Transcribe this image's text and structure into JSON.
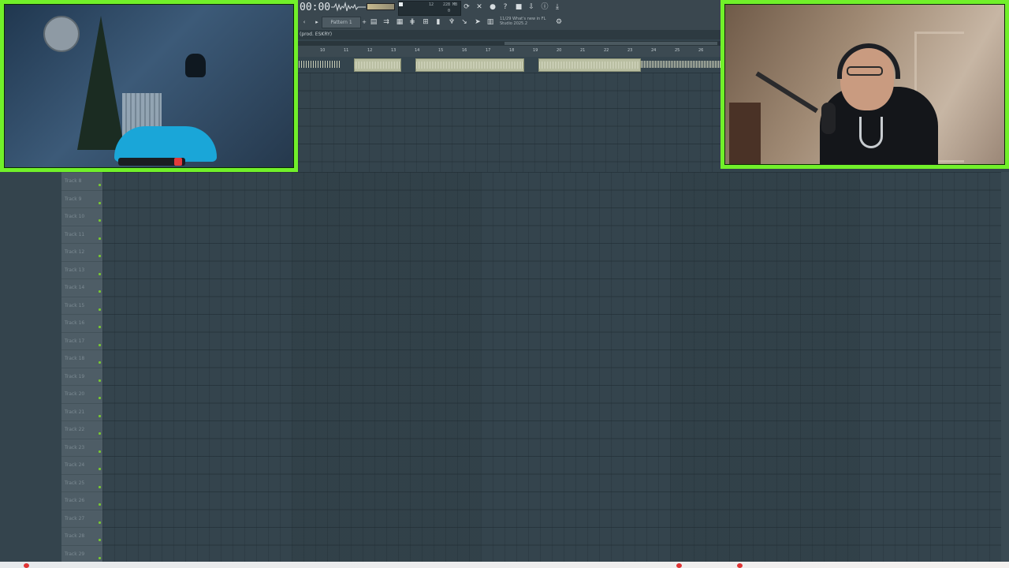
{
  "app": {
    "name": "FL Studio"
  },
  "toolbar": {
    "time": "00:00",
    "pattern": "Pattern 1",
    "cpu_top": "12",
    "cpu_mem": "228 MB",
    "cpu_bottom": "0",
    "news_line1": "11/29  What's new in FL",
    "news_line2": "Studio 2025.2"
  },
  "song": {
    "title": "(prod. ESKRY)"
  },
  "timeline": {
    "bars": [
      "10",
      "11",
      "12",
      "13",
      "14",
      "15",
      "16",
      "17",
      "18",
      "19",
      "20",
      "21",
      "22",
      "23",
      "24",
      "25",
      "26"
    ]
  },
  "tracks": [
    {
      "label": "Track 8"
    },
    {
      "label": "Track 9"
    },
    {
      "label": "Track 10"
    },
    {
      "label": "Track 11"
    },
    {
      "label": "Track 12"
    },
    {
      "label": "Track 13"
    },
    {
      "label": "Track 14"
    },
    {
      "label": "Track 15"
    },
    {
      "label": "Track 16"
    },
    {
      "label": "Track 17"
    },
    {
      "label": "Track 18"
    },
    {
      "label": "Track 19"
    },
    {
      "label": "Track 20"
    },
    {
      "label": "Track 21"
    },
    {
      "label": "Track 22"
    },
    {
      "label": "Track 23"
    },
    {
      "label": "Track 24"
    },
    {
      "label": "Track 25"
    },
    {
      "label": "Track 26"
    },
    {
      "label": "Track 27"
    },
    {
      "label": "Track 28"
    },
    {
      "label": "Track 29"
    }
  ],
  "toolbar_icons": [
    "playlist-icon",
    "piano-roll-icon",
    "mixer-icon",
    "channel-rack-icon",
    "browser-icon",
    "plugin-picker-icon",
    "touch-keyboard-icon",
    "audio-editor-icon",
    "record-icon",
    "help-icon",
    "save-icon",
    "export-icon",
    "info-icon",
    "download-icon"
  ],
  "colors": {
    "cam_border": "#71f02a",
    "playlist_bg": "#34444d",
    "clip": "#b9bea1",
    "track_led": "#78c832",
    "record": "#e23b3b"
  }
}
